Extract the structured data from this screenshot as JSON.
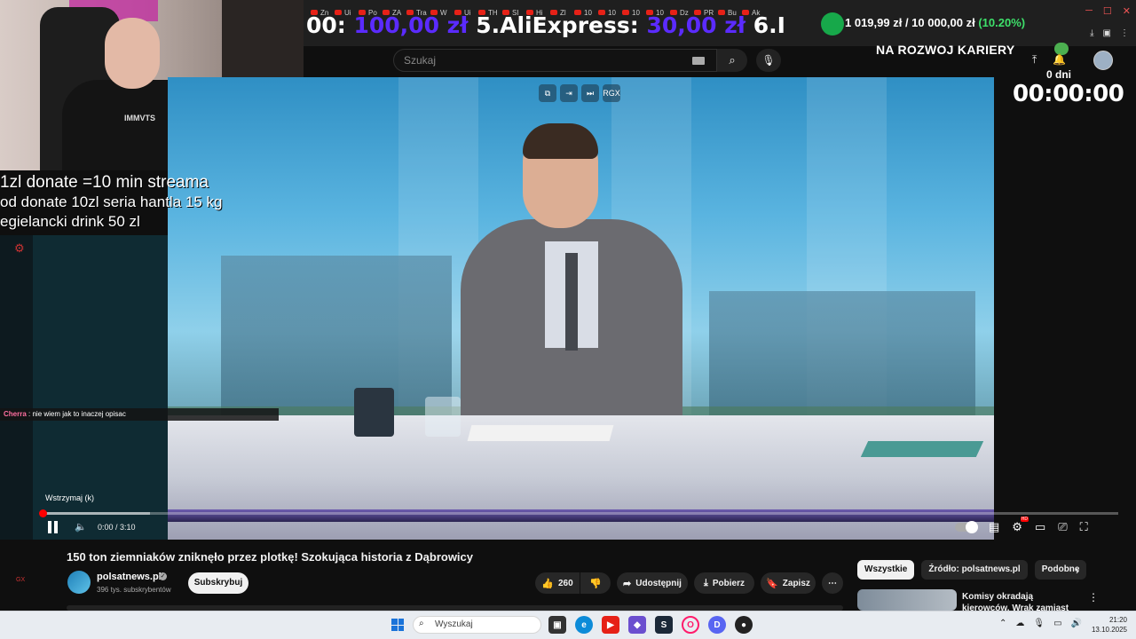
{
  "browser": {
    "tabs": [
      "Zn",
      "Ui",
      "Po",
      "ZA",
      "Tra",
      "W",
      "Ui",
      "TH",
      "SI",
      "Hi",
      "Zl",
      "10",
      "10",
      "10",
      "10",
      "Dz",
      "PR",
      "Bu",
      "Ak"
    ],
    "window_controls": [
      "─",
      "☐",
      "✕"
    ]
  },
  "ticker": {
    "prefix": "00: ",
    "amount1": "100,00 zł",
    "item": "  5.AliExpress: ",
    "amount2": "30,00 zł",
    "suffix": "  6.I"
  },
  "goal": {
    "text": "1 019,99 zł / 10 000,00 zł ",
    "percent": "(10.20%)",
    "title": "NA ROZWOJ KARIERY"
  },
  "countdown": {
    "days": "0 dni",
    "time": "00:00:00"
  },
  "search": {
    "placeholder": "Szukaj"
  },
  "overlay": {
    "donate_lines": [
      "1zl donate =10 min streama",
      "od donate 10zl seria hantla 15 kg",
      "egielancki drink 50 zl"
    ],
    "chat_user": "Cherra",
    "chat_message": " : nie wiem jak to inaczej opisac",
    "side_label": "GX"
  },
  "player": {
    "tooltip": "Wstrzymaj (k)",
    "time": "0:00 / 3:10",
    "progress": 0,
    "buffered": 0.1,
    "overlay_buttons": [
      "⧉",
      "⇥",
      "⏭",
      "RGX"
    ]
  },
  "video": {
    "title": "150 ton ziemniaków zniknęło przez plotkę! Szokująca historia z Dąbrowicy",
    "channel": "polsatnews.pl",
    "subscribers": "396 tys. subskrybentów",
    "subscribe": "Subskrybuj",
    "likes": "260",
    "share": "Udostępnij",
    "download": "Pobierz",
    "save": "Zapisz",
    "more": "⋯"
  },
  "chips": [
    "Wszystkie",
    "Źródło: polsatnews.pl",
    "Podobne"
  ],
  "recommendation": {
    "title": "Komisy okradają kierowców. Wrak zamiast auta"
  },
  "taskbar": {
    "search": "Wyszukaj",
    "time": "21:20",
    "date": "13.10.2025"
  },
  "colors": {
    "accent_red": "#ff0000",
    "ticker_amount": "#5b2bff",
    "goal_percent": "#3ee06a",
    "chat_name": "#ff6fa0"
  }
}
